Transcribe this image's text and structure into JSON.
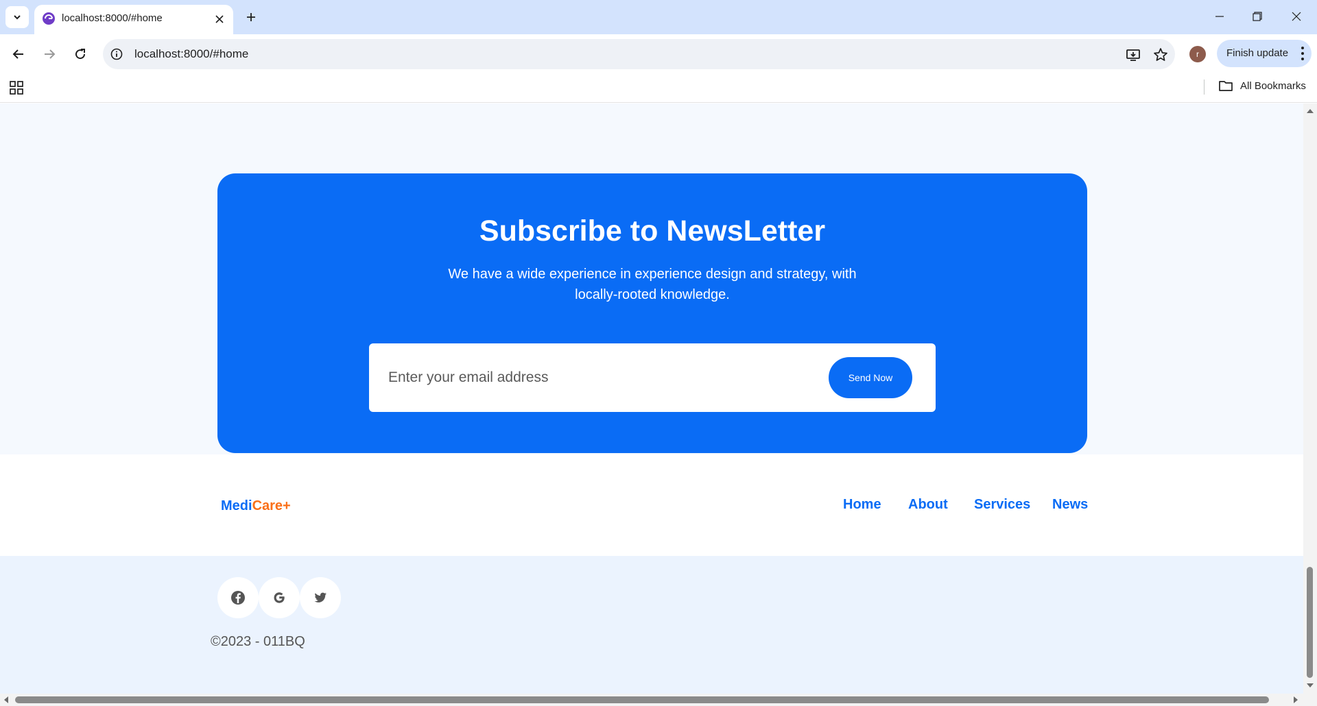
{
  "browser": {
    "tab_title": "localhost:8000/#home",
    "url": "localhost:8000/#home",
    "profile_initial": "r",
    "finish_update_label": "Finish update",
    "all_bookmarks_label": "All Bookmarks"
  },
  "newsletter": {
    "title": "Subscribe to NewsLetter",
    "text": "We have a wide experience in experience design and strategy, with locally-rooted knowledge.",
    "email_placeholder": "Enter your email address",
    "send_label": "Send Now"
  },
  "footer": {
    "brand_part1": "Medi",
    "brand_part2": "Care+",
    "nav": [
      "Home",
      "About",
      "Services",
      "News"
    ],
    "social": [
      "facebook-icon",
      "google-icon",
      "twitter-icon"
    ],
    "copyright": "©2023 - 011BQ"
  },
  "colors": {
    "primary": "#0a6cf5",
    "accent": "#fa6f18",
    "page_background": "#f5f9fe",
    "footer_background": "#ebf3fe"
  }
}
